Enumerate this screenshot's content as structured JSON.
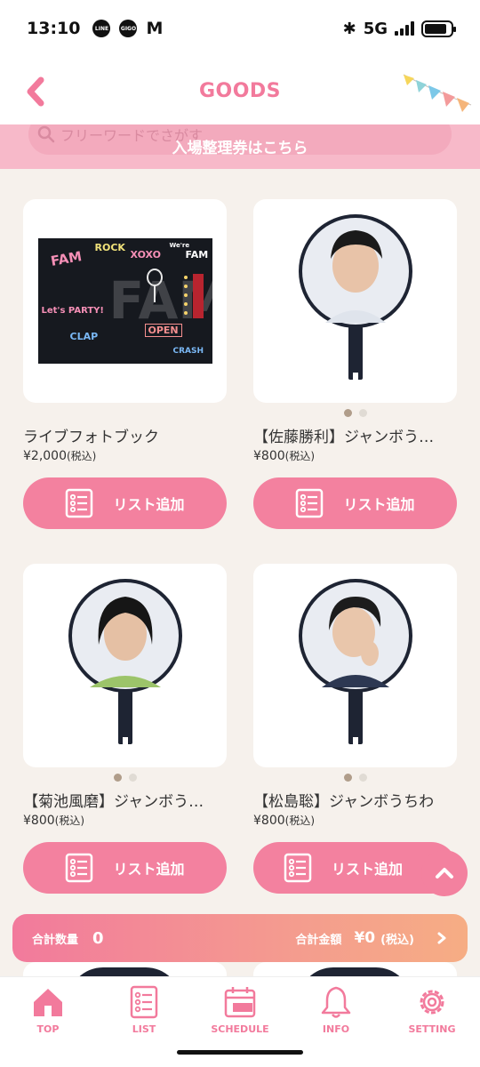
{
  "status_bar": {
    "time": "13:10",
    "apps": [
      "LINE",
      "GIGO"
    ],
    "network": "5G",
    "battery_level": 0.85,
    "icons": [
      "line-icon",
      "gigo-icon",
      "mail-icon",
      "bluetooth-icon",
      "signal-icon",
      "battery-icon"
    ]
  },
  "header": {
    "title": "GOODS"
  },
  "search": {
    "placeholder": "フリーワードでさがす"
  },
  "banner": {
    "label": "入場整理券はこちら"
  },
  "products": [
    {
      "name": "ライブフォトブック",
      "price": "¥2,000",
      "tax": "(税込)",
      "button_label": "リスト追加",
      "image": "photobook",
      "dots": 0,
      "active_dot": 0
    },
    {
      "name": "【佐藤勝利】ジャンボう…",
      "price": "¥800",
      "tax": "(税込)",
      "button_label": "リスト追加",
      "image": "uchiwa",
      "dots": 2,
      "active_dot": 0
    },
    {
      "name": "【菊池風磨】ジャンボう…",
      "price": "¥800",
      "tax": "(税込)",
      "button_label": "リスト追加",
      "image": "uchiwa",
      "dots": 2,
      "active_dot": 0
    },
    {
      "name": "【松島聡】ジャンボうちわ",
      "price": "¥800",
      "tax": "(税込)",
      "button_label": "リスト追加",
      "image": "uchiwa",
      "dots": 2,
      "active_dot": 0
    }
  ],
  "photobook_art": {
    "words": [
      "FAM",
      "ROCK",
      "XOXO",
      "FAM",
      "Let's PARTY!",
      "CLAP",
      "OPEN",
      "CRASH",
      "We're"
    ]
  },
  "totals": {
    "qty_label": "合計数量",
    "qty_value": "0",
    "amount_label": "合計金額",
    "amount_value": "¥0",
    "tax_label": "(税込)"
  },
  "nav": {
    "items": [
      {
        "label": "TOP",
        "icon": "home-icon"
      },
      {
        "label": "LIST",
        "icon": "list-icon"
      },
      {
        "label": "SCHEDULE",
        "icon": "calendar-icon"
      },
      {
        "label": "INFO",
        "icon": "bell-icon"
      },
      {
        "label": "SETTING",
        "icon": "gear-icon"
      }
    ],
    "active": 0
  },
  "colors": {
    "accent_pink": "#f3819f",
    "title_pink": "#f27a9c",
    "banner_pink": "#f7b9c9",
    "background": "#f6f1ec",
    "gradient_end": "#f6ad84"
  }
}
